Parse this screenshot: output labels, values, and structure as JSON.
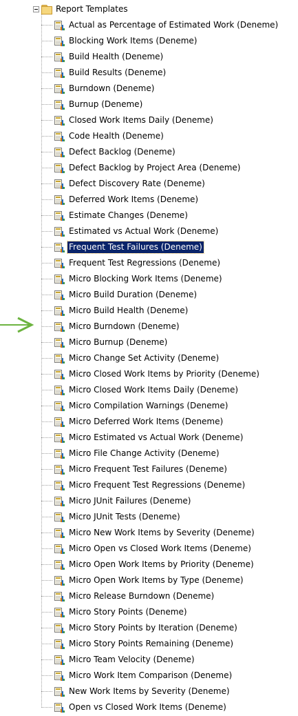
{
  "tree": {
    "root_label": "Report Templates",
    "items": [
      "Actual as Percentage of Estimated Work (Deneme)",
      "Blocking Work Items (Deneme)",
      "Build Health (Deneme)",
      "Build Results (Deneme)",
      "Burndown (Deneme)",
      "Burnup (Deneme)",
      "Closed Work Items Daily (Deneme)",
      "Code Health (Deneme)",
      "Defect Backlog (Deneme)",
      "Defect Backlog by Project Area (Deneme)",
      "Defect Discovery Rate (Deneme)",
      "Deferred Work Items (Deneme)",
      "Estimate Changes (Deneme)",
      "Estimated vs Actual Work (Deneme)",
      "Frequent Test Failures (Deneme)",
      "Frequent Test Regressions (Deneme)",
      "Micro Blocking Work Items (Deneme)",
      "Micro Build Duration (Deneme)",
      "Micro Build Health (Deneme)",
      "Micro Burndown (Deneme)",
      "Micro Burnup (Deneme)",
      "Micro Change Set Activity (Deneme)",
      "Micro Closed Work Items by Priority (Deneme)",
      "Micro Closed Work Items Daily (Deneme)",
      "Micro Compilation Warnings (Deneme)",
      "Micro Deferred Work Items (Deneme)",
      "Micro Estimated vs Actual Work (Deneme)",
      "Micro File Change Activity (Deneme)",
      "Micro Frequent Test Failures (Deneme)",
      "Micro Frequent Test Regressions (Deneme)",
      "Micro JUnit Failures (Deneme)",
      "Micro JUnit Tests (Deneme)",
      "Micro New Work Items by Severity (Deneme)",
      "Micro Open vs Closed Work Items (Deneme)",
      "Micro Open Work Items by Priority (Deneme)",
      "Micro Open Work Items by Type (Deneme)",
      "Micro Release Burndown (Deneme)",
      "Micro Story Points (Deneme)",
      "Micro Story Points by Iteration (Deneme)",
      "Micro Story Points Remaining (Deneme)",
      "Micro Team Velocity (Deneme)",
      "Micro Work Item Comparison (Deneme)",
      "New Work Items by Severity (Deneme)",
      "Open vs Closed Work Items (Deneme)"
    ],
    "selected_index": 14,
    "arrow_index": 19
  },
  "icons": {
    "root_expander": "collapse-minus-icon",
    "root_folder": "folder-icon",
    "item": "report-template-icon",
    "pointer": "green-arrow-icon"
  },
  "colors": {
    "selection_bg": "#0a246a",
    "selection_text": "#ffffff",
    "arrow": "#6cb33f"
  }
}
